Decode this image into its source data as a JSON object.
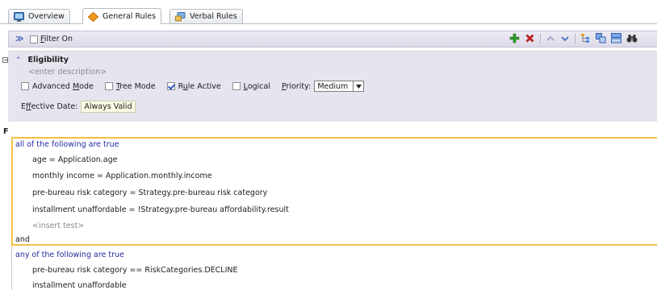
{
  "tabs": [
    {
      "label": "Overview",
      "icon": "overview-icon",
      "active": false
    },
    {
      "label": "General Rules",
      "icon": "diamond-icon",
      "active": true
    },
    {
      "label": "Verbal Rules",
      "icon": "verbal-rules-icon",
      "active": false
    }
  ],
  "toolbar": {
    "filter_label": "Filter On",
    "filter_mnemonic": "F",
    "filter_rest": "ilter On",
    "filter_checked": false
  },
  "rule": {
    "name": "Eligibility",
    "description_placeholder": "<enter description>",
    "options": [
      {
        "label": "Advanced Mode",
        "mnemonic": "M",
        "checked": false
      },
      {
        "label": "Tree Mode",
        "mnemonic": "T",
        "checked": false
      },
      {
        "label": "Rule Active",
        "mnemonic": "u",
        "checked": true
      },
      {
        "label": "Logical",
        "mnemonic": "L",
        "checked": false
      }
    ],
    "priority_label": "Priority:",
    "priority_value": "Medium",
    "effective_date_label": "Effective Date:",
    "effective_date_value": "Always Valid"
  },
  "condition": {
    "if_label": "F",
    "group1_header": "all of the following are true",
    "group1_tests": [
      "age = Application.age",
      "monthly income = Application.monthly.income",
      "pre-bureau risk category = Strategy.pre-bureau risk category",
      "installment unaffordable = !Strategy.pre-bureau affordability.result"
    ],
    "insert_placeholder": "<insert test>",
    "connector": "and",
    "group2_header": "any of the following are true",
    "group2_tests": [
      "pre-bureau risk category  ==  RiskCategories.DECLINE",
      "installment unaffordable"
    ]
  },
  "colors": {
    "accent": "#f4c043",
    "keyword": "#232aa0",
    "panel": "#e6e4ef",
    "add_green": "#2e9a2a",
    "delete_red": "#d42525"
  }
}
